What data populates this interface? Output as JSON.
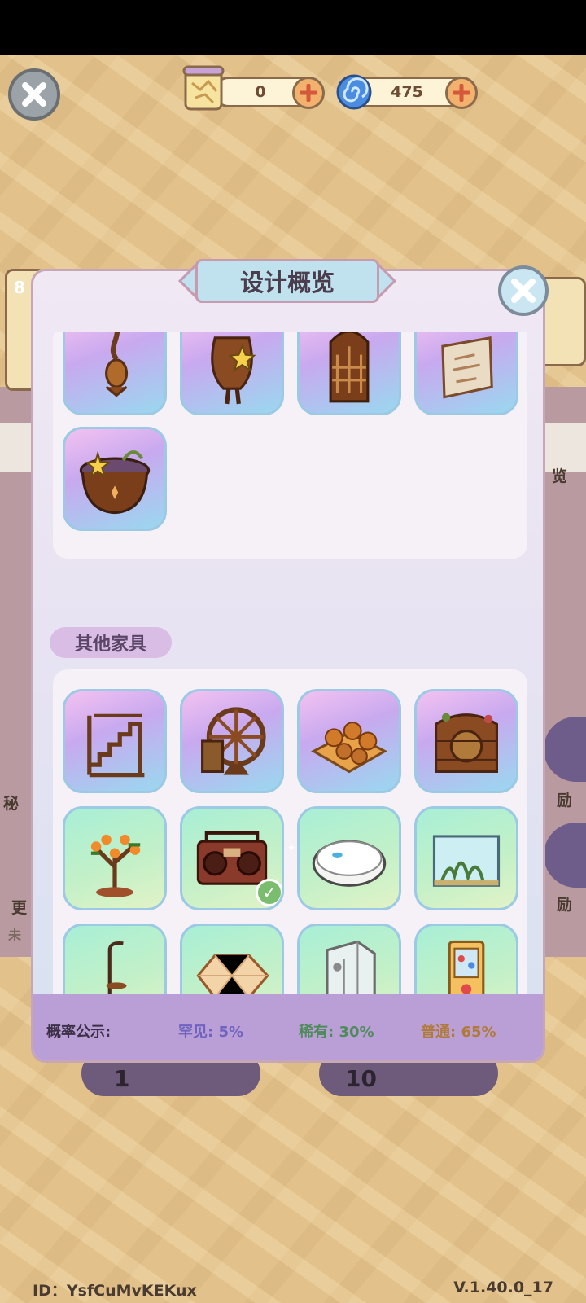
{
  "header": {
    "resources": [
      {
        "name": "map-scroll",
        "value": "0"
      },
      {
        "name": "spiral-gem",
        "value": "475"
      }
    ]
  },
  "background": {
    "left_badge": "8",
    "left_label_1": "秘",
    "left_label_2": "更",
    "left_label_3": "未",
    "right_label_1": "览",
    "right_label_2": "励",
    "right_label_3": "励",
    "draw_count_1": "1",
    "draw_count_10": "10"
  },
  "dialog": {
    "title": "设计概览",
    "section_other": "其他家具",
    "top_items": [
      {
        "name": "hanging-ornament",
        "rarity": "rare"
      },
      {
        "name": "wooden-vase-with-star",
        "rarity": "rare"
      },
      {
        "name": "gothic-window-screen",
        "rarity": "rare"
      },
      {
        "name": "framed-map-board",
        "rarity": "rare"
      },
      {
        "name": "witch-cauldron",
        "rarity": "rare"
      }
    ],
    "other_items": [
      {
        "name": "wooden-staircase",
        "rarity": "rare",
        "owned": false
      },
      {
        "name": "waterwheel",
        "rarity": "rare",
        "owned": false
      },
      {
        "name": "bread-platter",
        "rarity": "rare",
        "owned": false
      },
      {
        "name": "barrel-cabinet",
        "rarity": "rare",
        "owned": false
      },
      {
        "name": "orange-bonsai",
        "rarity": "common",
        "owned": false
      },
      {
        "name": "boombox-radio",
        "rarity": "common",
        "owned": true
      },
      {
        "name": "robot-vacuum",
        "rarity": "common",
        "owned": false
      },
      {
        "name": "aquarium-tank",
        "rarity": "common",
        "owned": false
      },
      {
        "name": "standing-lamp-table",
        "rarity": "common",
        "owned": false
      },
      {
        "name": "geometric-rug",
        "rarity": "common",
        "owned": false
      },
      {
        "name": "shower-cabin",
        "rarity": "common",
        "owned": false
      },
      {
        "name": "gashapon-machine",
        "rarity": "common",
        "owned": false
      }
    ],
    "probability": {
      "label": "概率公示:",
      "rare": "罕见: 5%",
      "uncommon": "稀有: 30%",
      "common": "普通: 65%",
      "colors": {
        "rare": "#7b6fc4",
        "uncommon": "#4f8a5b",
        "common": "#b07a3a"
      }
    }
  },
  "footer": {
    "id": "ID：YsfCuMvKEKux",
    "version": "V.1.40.0_17"
  }
}
